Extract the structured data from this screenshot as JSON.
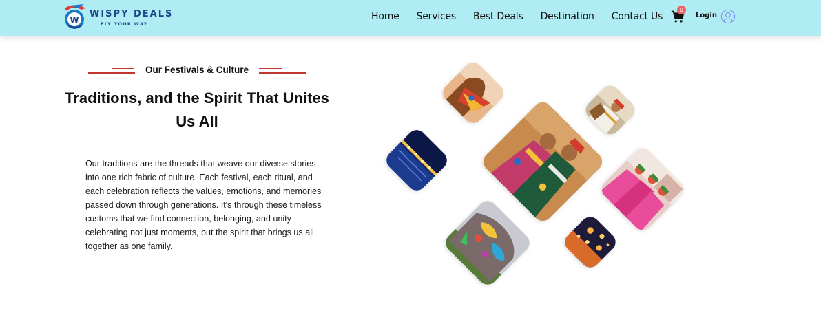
{
  "brand": {
    "name": "WISPY DEALS",
    "tagline": "FLY YOUR WAY",
    "logo_icon": "plane-globe-logo",
    "colors": {
      "primary": "#1a4a8a",
      "accent": "#e03a3a"
    }
  },
  "nav": {
    "links": [
      "Home",
      "Services",
      "Best Deals",
      "Destination",
      "Contact Us"
    ],
    "cart_icon": "shopping-cart-icon",
    "cart_count": "0",
    "login_label": "Login",
    "user_icon": "user-circle-icon",
    "bg_color": "#b0ecf4"
  },
  "section": {
    "eyebrow": "Our Festivals & Culture",
    "title": "Traditions, and the Spirit That Unites Us All",
    "body": "Our traditions are the threads that weave our diverse stories into one rich fabric of culture. Each festival, each ritual, and each celebration reflects the values, emotions, and memories passed down through generations. It's through these timeless customs that we find connection, belonging, and unity — celebrating not just moments, but the spirit that brings us all together as one family.",
    "accent_color": "#c0362c"
  },
  "gallery": {
    "images": [
      {
        "name": "camel-festival-photo"
      },
      {
        "name": "folk-musician-photo"
      },
      {
        "name": "river-lights-photo"
      },
      {
        "name": "dancers-couple-photo"
      },
      {
        "name": "women-in-pink-photo"
      },
      {
        "name": "painted-elephant-photo"
      },
      {
        "name": "sky-lanterns-photo"
      }
    ]
  }
}
